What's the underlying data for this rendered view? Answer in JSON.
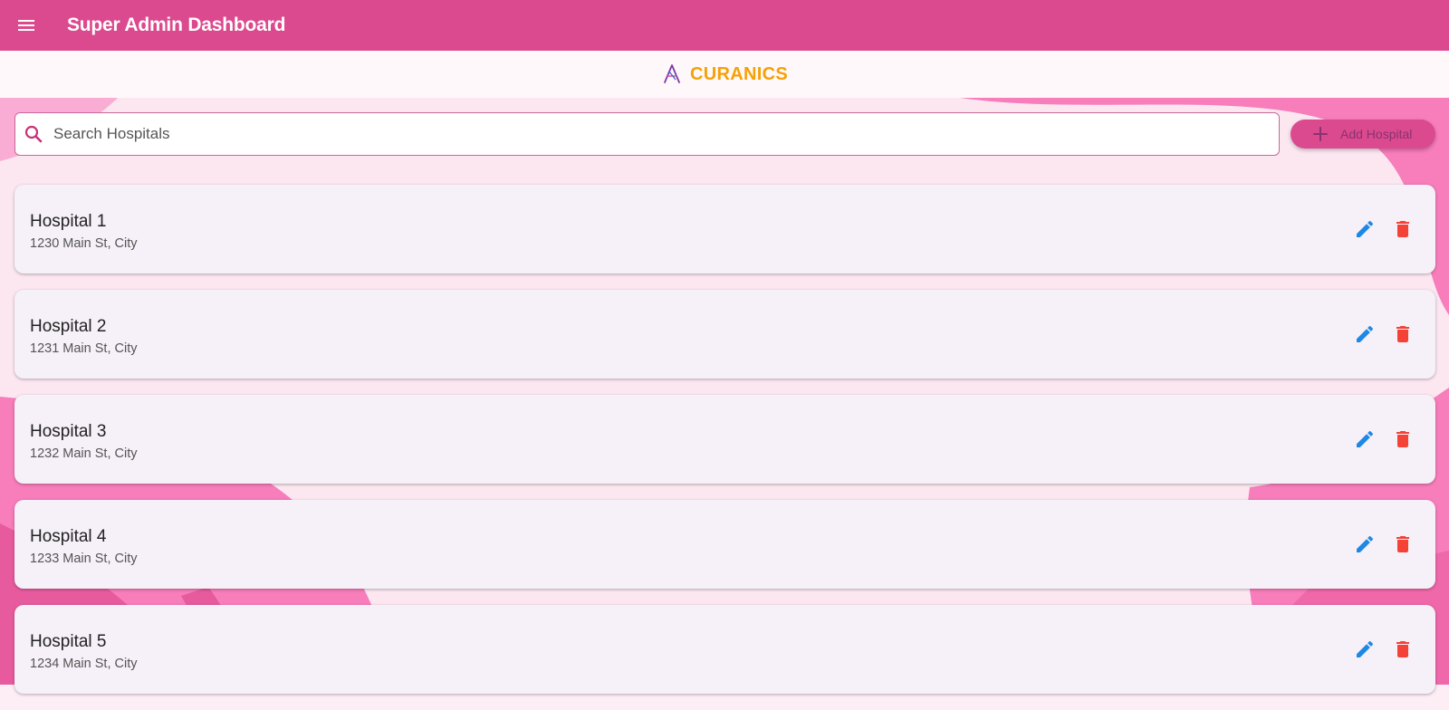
{
  "app_bar": {
    "title": "Super Admin Dashboard",
    "menu_icon": "menu-icon",
    "background": "#db4a8e"
  },
  "brand": {
    "name": "CURANICS",
    "logo_icon": "curanics-logo-icon",
    "color": "#f5a106"
  },
  "search": {
    "placeholder": "Search Hospitals",
    "value": "",
    "icon": "search-icon"
  },
  "add_button": {
    "label": "Add Hospital",
    "icon": "plus-icon"
  },
  "hospitals": [
    {
      "name": "Hospital 1",
      "address": "1230 Main St, City"
    },
    {
      "name": "Hospital 2",
      "address": "1231 Main St, City"
    },
    {
      "name": "Hospital 3",
      "address": "1232 Main St, City"
    },
    {
      "name": "Hospital 4",
      "address": "1233 Main St, City"
    },
    {
      "name": "Hospital 5",
      "address": "1234 Main St, City"
    }
  ],
  "row_actions": {
    "edit_icon": "pencil-icon",
    "delete_icon": "trash-icon",
    "edit_color": "#1e88e5",
    "delete_color": "#f44336"
  }
}
